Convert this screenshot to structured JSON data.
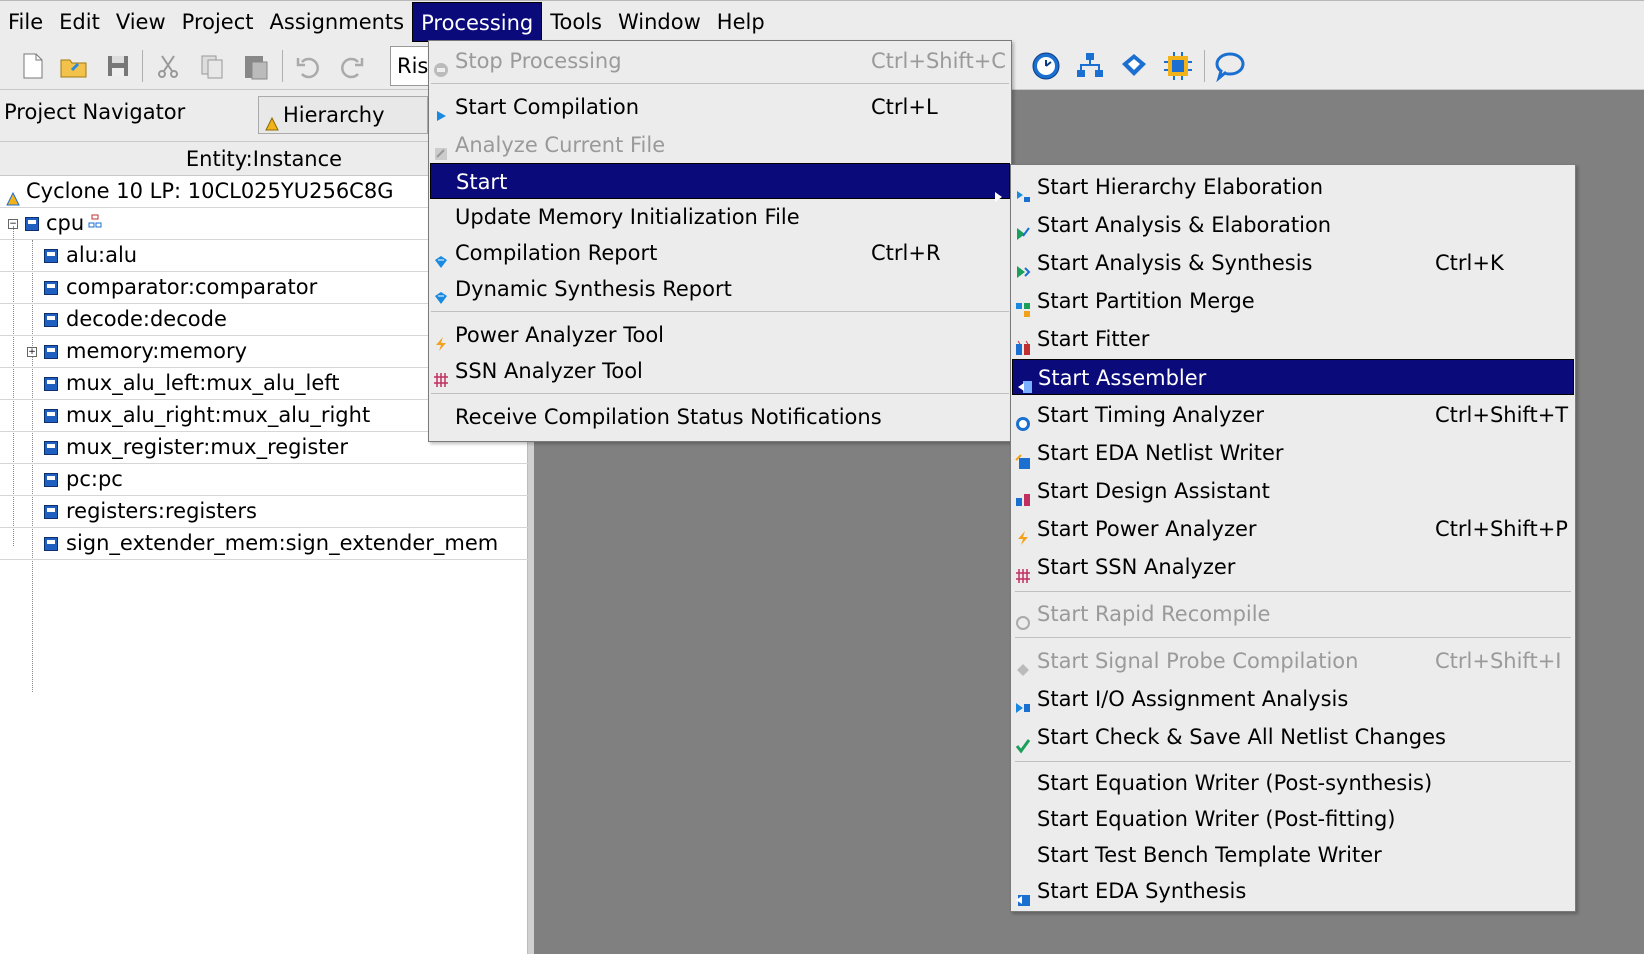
{
  "menubar": {
    "items": [
      "File",
      "Edit",
      "View",
      "Project",
      "Assignments",
      "Processing",
      "Tools",
      "Window",
      "Help"
    ],
    "active": "Processing"
  },
  "toolbar": {
    "revision_text": "Ris",
    "accent_color": "#0a0a7a"
  },
  "navigator": {
    "title": "Project Navigator",
    "view_selector": "Hierarchy",
    "column_header": "Entity:Instance",
    "device": "Cyclone 10 LP: 10CL025YU256C8G",
    "top_entity": "cpu",
    "instances": [
      "alu:alu",
      "comparator:comparator",
      "decode:decode",
      "memory:memory",
      "mux_alu_left:mux_alu_left",
      "mux_alu_right:mux_alu_right",
      "mux_register:mux_register",
      "pc:pc",
      "registers:registers",
      "sign_extender_mem:sign_extender_mem"
    ]
  },
  "processing_menu": {
    "items": [
      {
        "label": "Stop Processing",
        "shortcut": "Ctrl+Shift+C",
        "disabled": true,
        "icon": "stop-icon"
      },
      {
        "label": "Start Compilation",
        "shortcut": "Ctrl+L",
        "icon": "play-icon"
      },
      {
        "label": "Analyze Current File",
        "shortcut": "",
        "disabled": true,
        "icon": "analyze-icon"
      },
      {
        "label": "Start",
        "shortcut": "",
        "highlighted": true,
        "submenu": true
      },
      {
        "label": "Update Memory Initialization File",
        "shortcut": ""
      },
      {
        "label": "Compilation Report",
        "shortcut": "Ctrl+R",
        "icon": "report-icon"
      },
      {
        "label": "Dynamic Synthesis Report",
        "shortcut": "",
        "icon": "report-icon"
      },
      {
        "label": "Power Analyzer Tool",
        "shortcut": "",
        "icon": "power-icon"
      },
      {
        "label": "SSN Analyzer Tool",
        "shortcut": "",
        "icon": "ssn-icon"
      },
      {
        "label": "Receive Compilation Status Notifications",
        "shortcut": ""
      }
    ]
  },
  "start_submenu": {
    "items": [
      {
        "label": "Start Hierarchy Elaboration",
        "shortcut": ""
      },
      {
        "label": "Start Analysis & Elaboration",
        "shortcut": ""
      },
      {
        "label": "Start Analysis & Synthesis",
        "shortcut": "Ctrl+K"
      },
      {
        "label": "Start Partition Merge",
        "shortcut": ""
      },
      {
        "label": "Start Fitter",
        "shortcut": ""
      },
      {
        "label": "Start Assembler",
        "shortcut": "",
        "highlighted": true
      },
      {
        "label": "Start Timing Analyzer",
        "shortcut": "Ctrl+Shift+T"
      },
      {
        "label": "Start EDA Netlist Writer",
        "shortcut": ""
      },
      {
        "label": "Start Design Assistant",
        "shortcut": ""
      },
      {
        "label": "Start Power Analyzer",
        "shortcut": "Ctrl+Shift+P"
      },
      {
        "label": "Start SSN Analyzer",
        "shortcut": ""
      },
      {
        "label": "Start Rapid Recompile",
        "shortcut": "",
        "disabled": true
      },
      {
        "label": "Start Signal Probe Compilation",
        "shortcut": "Ctrl+Shift+I",
        "disabled": true
      },
      {
        "label": "Start I/O Assignment Analysis",
        "shortcut": ""
      },
      {
        "label": "Start Check & Save All Netlist Changes",
        "shortcut": ""
      },
      {
        "label": "Start Equation Writer (Post-synthesis)",
        "shortcut": ""
      },
      {
        "label": "Start Equation Writer (Post-fitting)",
        "shortcut": ""
      },
      {
        "label": "Start Test Bench Template Writer",
        "shortcut": ""
      },
      {
        "label": "Start EDA Synthesis",
        "shortcut": ""
      }
    ]
  }
}
